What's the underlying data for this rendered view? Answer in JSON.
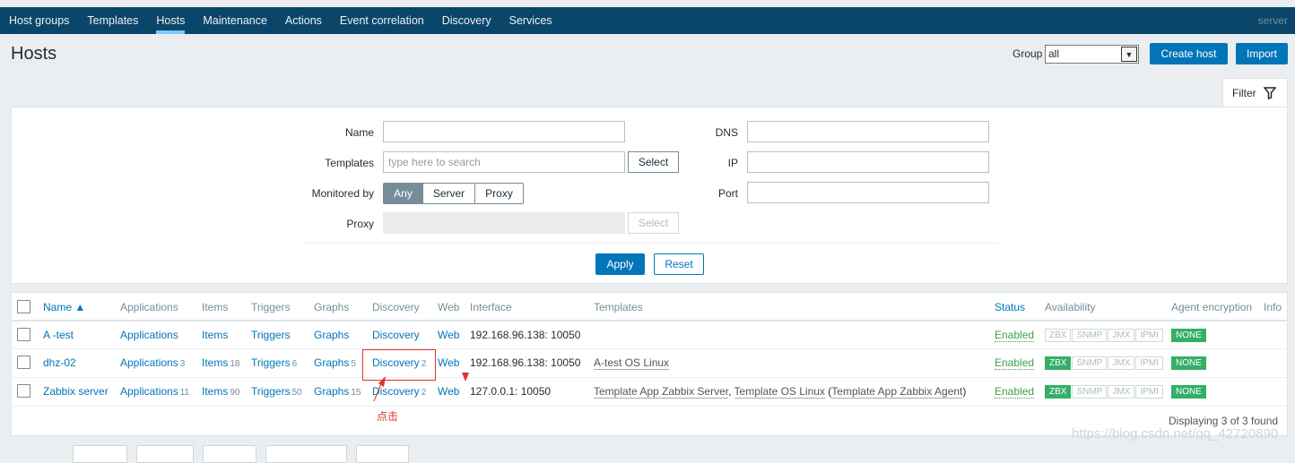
{
  "nav": {
    "items": [
      "Host groups",
      "Templates",
      "Hosts",
      "Maintenance",
      "Actions",
      "Event correlation",
      "Discovery",
      "Services"
    ],
    "active": "Hosts",
    "server": "server"
  },
  "header": {
    "title": "Hosts",
    "group_label": "Group",
    "group_value": "all",
    "create_label": "Create host",
    "import_label": "Import"
  },
  "filter": {
    "tab_label": "Filter",
    "name_label": "Name",
    "templates_label": "Templates",
    "templates_placeholder": "type here to search",
    "select_label": "Select",
    "monitored_label": "Monitored by",
    "monitored_options": [
      "Any",
      "Server",
      "Proxy"
    ],
    "monitored_selected": "Any",
    "proxy_label": "Proxy",
    "dns_label": "DNS",
    "ip_label": "IP",
    "port_label": "Port",
    "apply_label": "Apply",
    "reset_label": "Reset"
  },
  "table": {
    "columns": [
      "Name ▲",
      "Applications",
      "Items",
      "Triggers",
      "Graphs",
      "Discovery",
      "Web",
      "Interface",
      "Templates",
      "Status",
      "Availability",
      "Agent encryption",
      "Info"
    ],
    "rows": [
      {
        "name": "A -test",
        "applications": "Applications",
        "applications_count": "",
        "items": "Items",
        "items_count": "",
        "triggers": "Triggers",
        "triggers_count": "",
        "graphs": "Graphs",
        "graphs_count": "",
        "discovery": "Discovery",
        "discovery_count": "",
        "web": "Web",
        "interface": "192.168.96.138: 10050",
        "templates": "",
        "status": "Enabled",
        "availability": {
          "ZBX": false,
          "SNMP": false,
          "JMX": false,
          "IPMI": false
        },
        "encryption": "NONE"
      },
      {
        "name": "dhz-02",
        "applications": "Applications",
        "applications_count": "3",
        "items": "Items",
        "items_count": "18",
        "triggers": "Triggers",
        "triggers_count": "6",
        "graphs": "Graphs",
        "graphs_count": "5",
        "discovery": "Discovery",
        "discovery_count": "2",
        "web": "Web",
        "interface": "192.168.96.138: 10050",
        "templates": "A-test OS Linux",
        "status": "Enabled",
        "availability": {
          "ZBX": true,
          "SNMP": false,
          "JMX": false,
          "IPMI": false
        },
        "encryption": "NONE"
      },
      {
        "name": "Zabbix server",
        "applications": "Applications",
        "applications_count": "11",
        "items": "Items",
        "items_count": "90",
        "triggers": "Triggers",
        "triggers_count": "50",
        "graphs": "Graphs",
        "graphs_count": "15",
        "discovery": "Discovery",
        "discovery_count": "2",
        "web": "Web",
        "interface": "127.0.0.1: 10050",
        "templates_parts": [
          "Template App Zabbix Server",
          ", ",
          "Template OS Linux",
          " (",
          "Template App Zabbix Agent",
          ")"
        ],
        "status": "Enabled",
        "availability": {
          "ZBX": true,
          "SNMP": false,
          "JMX": false,
          "IPMI": false
        },
        "encryption": "NONE"
      }
    ],
    "footer": "Displaying 3 of 3 found"
  },
  "annotation": {
    "text": "点击"
  },
  "watermark": "https://blog.csdn.net/qq_42720890",
  "colors": {
    "nav_bg": "#0a466a",
    "link": "#0275b8",
    "enabled": "#429e47",
    "ok_badge": "#34af67",
    "annotation": "#e0312e"
  }
}
